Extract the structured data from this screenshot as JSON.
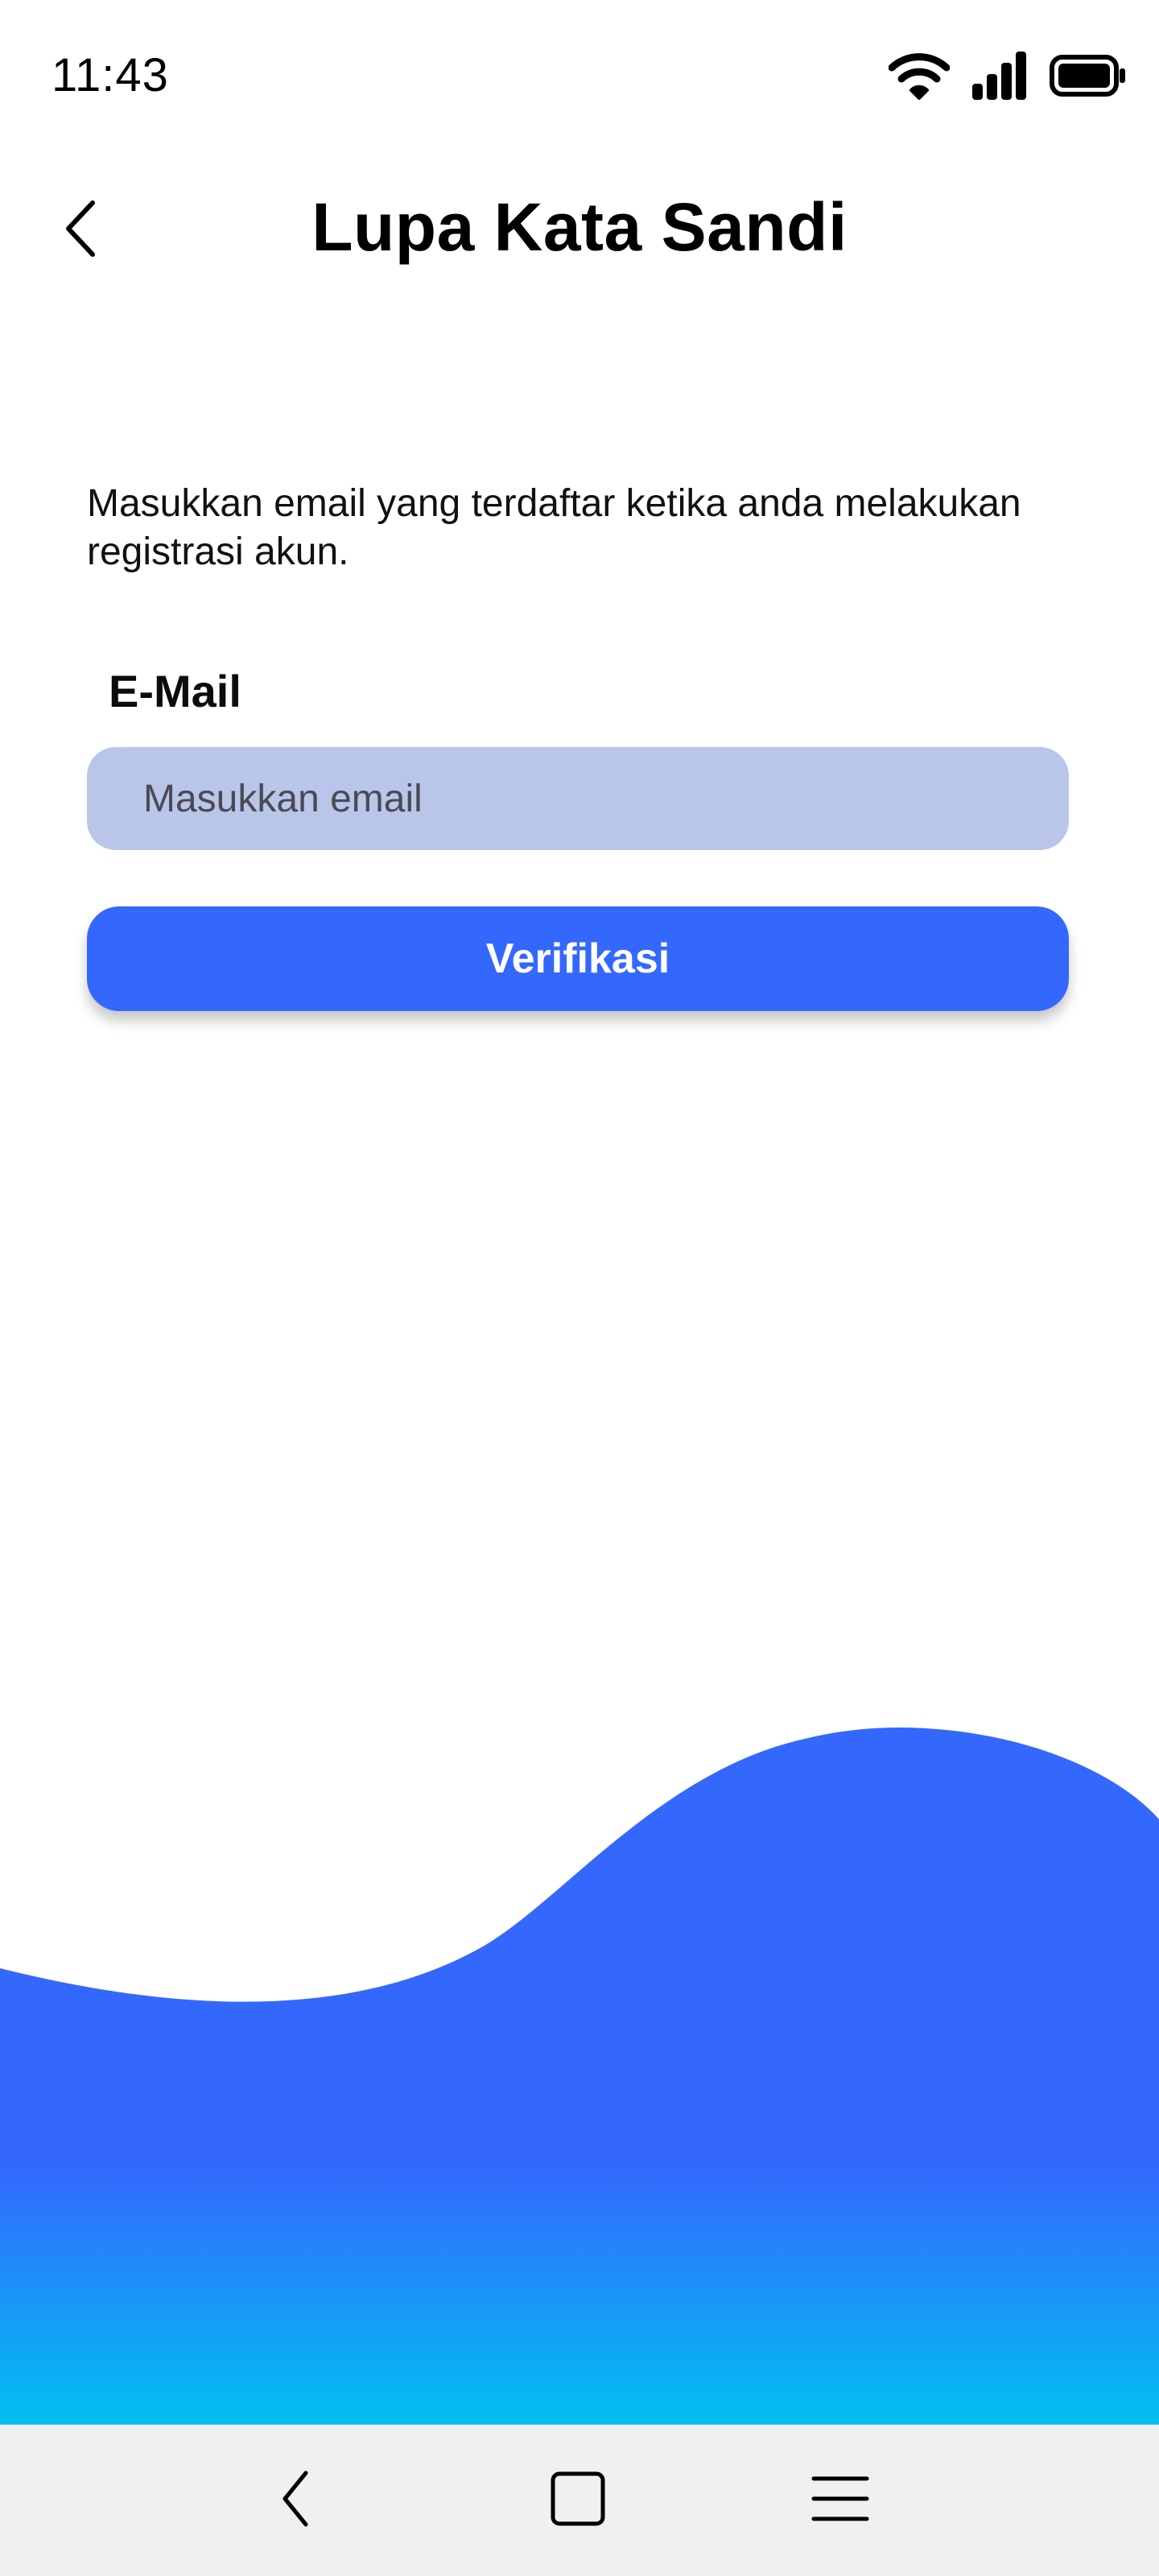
{
  "status_bar": {
    "time": "11:43",
    "icons": [
      "wifi-icon",
      "signal-icon",
      "battery-icon"
    ]
  },
  "header": {
    "title": "Lupa Kata Sandi",
    "back_icon": "chevron-left-icon"
  },
  "form": {
    "instruction": "Masukkan email yang terdaftar ketika anda melakukan registrasi akun.",
    "email_label": "E-Mail",
    "email_placeholder": "Masukkan email",
    "email_value": "",
    "submit_label": "Verifikasi"
  },
  "nav_bar": {
    "icons": [
      "back-icon",
      "home-icon",
      "menu-icon"
    ]
  },
  "colors": {
    "accent": "#3468FD",
    "input_background": "#B9C6E9",
    "wave_gradient_end": "#00C2F0",
    "nav_background": "#F0F0F0"
  }
}
